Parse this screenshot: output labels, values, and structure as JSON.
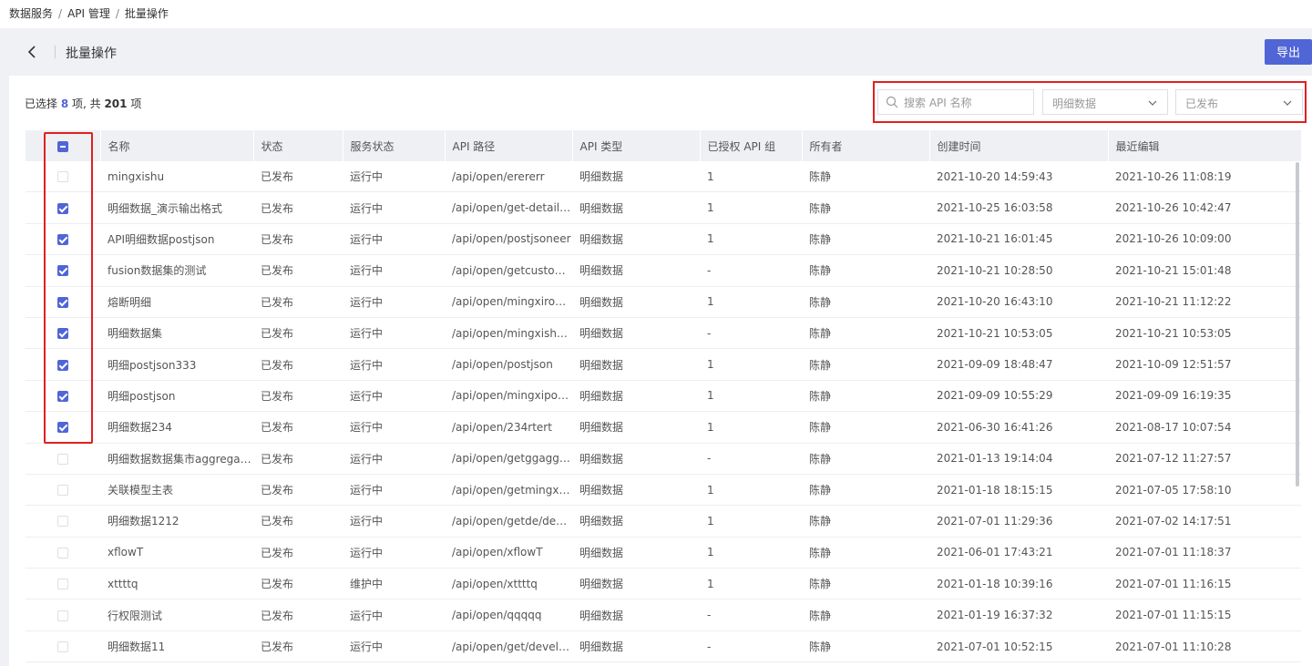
{
  "breadcrumb": [
    "数据服务",
    "API 管理",
    "批量操作"
  ],
  "page_title": "批量操作",
  "export_label": "导出",
  "selection": {
    "prefix": "已选择 ",
    "selected": "8",
    "middle": " 项, 共 ",
    "total": "201",
    "suffix": " 项"
  },
  "search": {
    "placeholder": "搜索 API 名称"
  },
  "filters": {
    "type_value": "明细数据",
    "status_value": "已发布"
  },
  "columns": [
    "名称",
    "状态",
    "服务状态",
    "API 路径",
    "API 类型",
    "已授权 API 组",
    "所有者",
    "创建时间",
    "最近编辑"
  ],
  "header_checkbox_state": "partial",
  "rows": [
    {
      "checked": false,
      "name": "mingxishu",
      "status": "已发布",
      "service": "运行中",
      "path": "/api/open/erererr",
      "type": "明细数据",
      "groups": "1",
      "owner": "陈静",
      "created": "2021-10-20 14:59:43",
      "edited": "2021-10-26 11:08:19"
    },
    {
      "checked": true,
      "name": "明细数据_演示输出格式",
      "status": "已发布",
      "service": "运行中",
      "path": "/api/open/get-detail-a...",
      "type": "明细数据",
      "groups": "1",
      "owner": "陈静",
      "created": "2021-10-25 16:03:58",
      "edited": "2021-10-26 10:42:47"
    },
    {
      "checked": true,
      "name": "API明细数据postjson",
      "status": "已发布",
      "service": "运行中",
      "path": "/api/open/postjsoneer",
      "type": "明细数据",
      "groups": "1",
      "owner": "陈静",
      "created": "2021-10-21 16:01:45",
      "edited": "2021-10-26 10:09:00"
    },
    {
      "checked": true,
      "name": "fusion数据集的测试",
      "status": "已发布",
      "service": "运行中",
      "path": "/api/open/getcustome...",
      "type": "明细数据",
      "groups": "-",
      "owner": "陈静",
      "created": "2021-10-21 10:28:50",
      "edited": "2021-10-21 15:01:48"
    },
    {
      "checked": true,
      "name": "熔断明细",
      "status": "已发布",
      "service": "运行中",
      "path": "/api/open/mingxirong...",
      "type": "明细数据",
      "groups": "1",
      "owner": "陈静",
      "created": "2021-10-20 16:43:10",
      "edited": "2021-10-21 11:12:22"
    },
    {
      "checked": true,
      "name": "明细数据集",
      "status": "已发布",
      "service": "运行中",
      "path": "/api/open/mingxishuj...",
      "type": "明细数据",
      "groups": "-",
      "owner": "陈静",
      "created": "2021-10-21 10:53:05",
      "edited": "2021-10-21 10:53:05"
    },
    {
      "checked": true,
      "name": "明细postjson333",
      "status": "已发布",
      "service": "运行中",
      "path": "/api/open/postjson",
      "type": "明细数据",
      "groups": "1",
      "owner": "陈静",
      "created": "2021-09-09 18:48:47",
      "edited": "2021-10-09 12:51:57"
    },
    {
      "checked": true,
      "name": "明细postjson",
      "status": "已发布",
      "service": "运行中",
      "path": "/api/open/mingxipostj...",
      "type": "明细数据",
      "groups": "1",
      "owner": "陈静",
      "created": "2021-09-09 10:55:29",
      "edited": "2021-09-09 16:19:35"
    },
    {
      "checked": true,
      "name": "明细数据234",
      "status": "已发布",
      "service": "运行中",
      "path": "/api/open/234rtert",
      "type": "明细数据",
      "groups": "1",
      "owner": "陈静",
      "created": "2021-06-30 16:41:26",
      "edited": "2021-08-17 10:07:54"
    },
    {
      "checked": false,
      "name": "明细数据数据集市aggregat...",
      "status": "已发布",
      "service": "运行中",
      "path": "/api/open/getggaggre...",
      "type": "明细数据",
      "groups": "-",
      "owner": "陈静",
      "created": "2021-01-13 19:14:04",
      "edited": "2021-07-12 11:27:57"
    },
    {
      "checked": false,
      "name": "关联模型主表",
      "status": "已发布",
      "service": "运行中",
      "path": "/api/open/getmingxid...",
      "type": "明细数据",
      "groups": "1",
      "owner": "陈静",
      "created": "2021-01-18 18:15:15",
      "edited": "2021-07-05 17:58:10"
    },
    {
      "checked": false,
      "name": "明细数据1212",
      "status": "已发布",
      "service": "运行中",
      "path": "/api/open/getde/deve...",
      "type": "明细数据",
      "groups": "1",
      "owner": "陈静",
      "created": "2021-07-01 11:29:36",
      "edited": "2021-07-02 14:17:51"
    },
    {
      "checked": false,
      "name": "xflowT",
      "status": "已发布",
      "service": "运行中",
      "path": "/api/open/xflowT",
      "type": "明细数据",
      "groups": "1",
      "owner": "陈静",
      "created": "2021-06-01 17:43:21",
      "edited": "2021-07-01 11:18:37"
    },
    {
      "checked": false,
      "name": "xttttq",
      "status": "已发布",
      "service": "维护中",
      "path": "/api/open/xttttq",
      "type": "明细数据",
      "groups": "1",
      "owner": "陈静",
      "created": "2021-01-18 10:39:16",
      "edited": "2021-07-01 11:16:15"
    },
    {
      "checked": false,
      "name": "行权限测试",
      "status": "已发布",
      "service": "运行中",
      "path": "/api/open/qqqqq",
      "type": "明细数据",
      "groups": "-",
      "owner": "陈静",
      "created": "2021-01-19 16:37:32",
      "edited": "2021-07-01 11:15:15"
    },
    {
      "checked": false,
      "name": "明细数据11",
      "status": "已发布",
      "service": "运行中",
      "path": "/api/open/get/develo...",
      "type": "明细数据",
      "groups": "-",
      "owner": "陈静",
      "created": "2021-07-01 10:52:15",
      "edited": "2021-07-01 11:10:28"
    }
  ],
  "colors": {
    "accent": "#5065d6",
    "highlight": "#e02020",
    "header_bg": "#eef0f4"
  },
  "icons": {
    "back": "chevron-left-icon",
    "search": "search-icon",
    "dropdown": "chevron-down-icon"
  }
}
